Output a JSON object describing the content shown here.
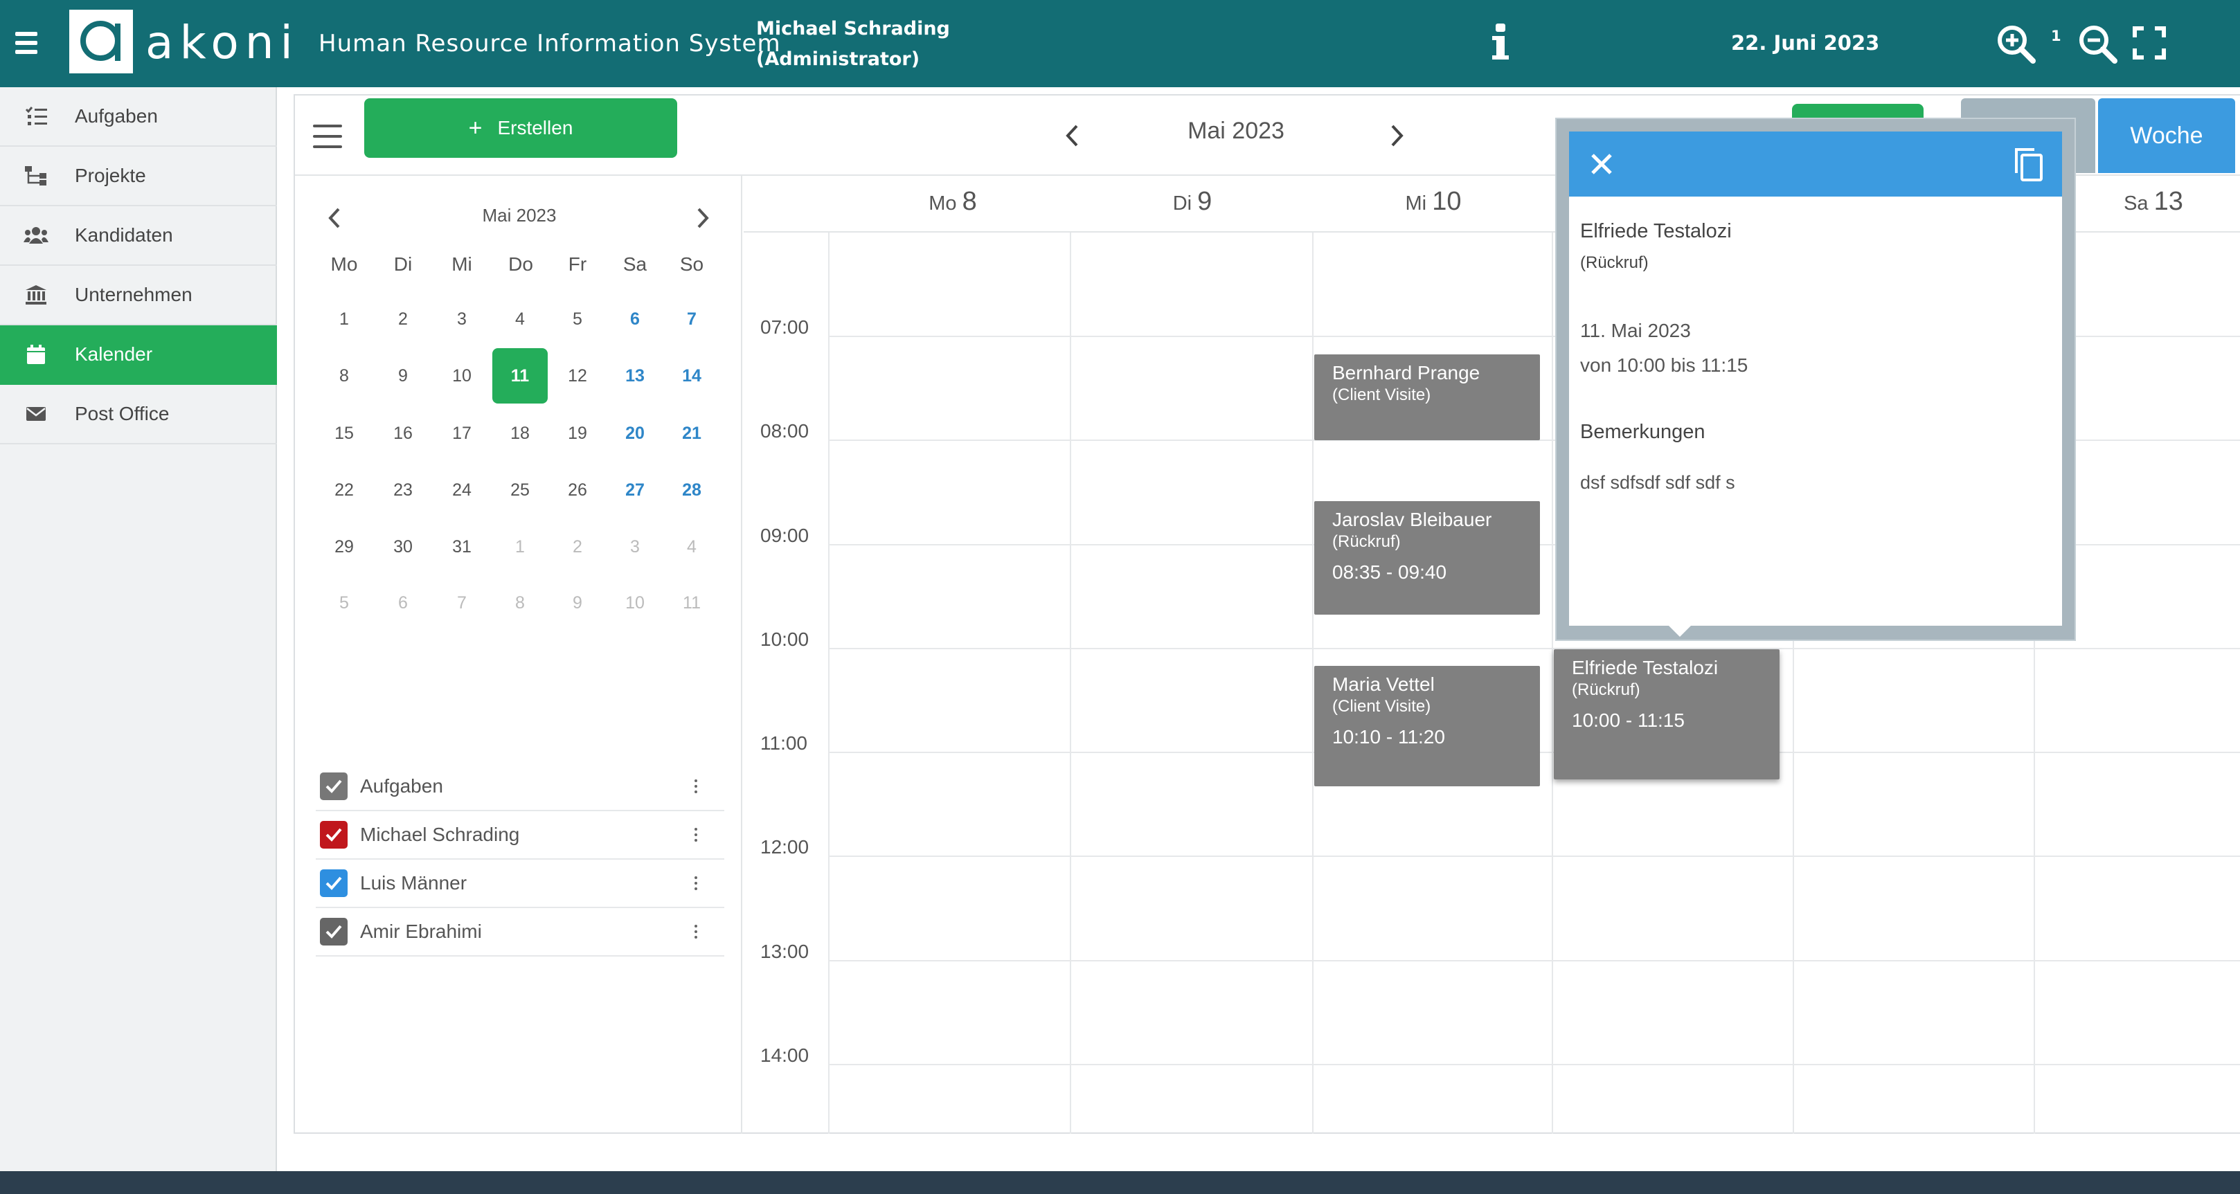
{
  "header": {
    "logo_text": "akoni",
    "app_title": "Human Resource Information System",
    "user_name": "Michael Schrading",
    "user_role": "(Administrator)",
    "date": "22. Juni 2023",
    "zoom_level": "1",
    "colors": {
      "bar": "#136d74"
    }
  },
  "sidebar": {
    "items": [
      {
        "label": "Aufgaben",
        "icon": "task-list-icon"
      },
      {
        "label": "Projekte",
        "icon": "project-tree-icon"
      },
      {
        "label": "Kandidaten",
        "icon": "users-icon"
      },
      {
        "label": "Unternehmen",
        "icon": "bank-icon"
      },
      {
        "label": "Kalender",
        "icon": "calendar-icon",
        "active": true
      },
      {
        "label": "Post Office",
        "icon": "envelope-icon"
      }
    ],
    "active_color": "#24ad5a"
  },
  "toolbar": {
    "create_label": "Erstellen",
    "month_title": "Mai 2023",
    "week_label": "Woche"
  },
  "mini_calendar": {
    "title": "Mai 2023",
    "weekdays": [
      "Mo",
      "Di",
      "Mi",
      "Do",
      "Fr",
      "Sa",
      "So"
    ],
    "weeks": [
      [
        "1",
        "2",
        "3",
        "4",
        "5",
        "6",
        "7"
      ],
      [
        "8",
        "9",
        "10",
        "11",
        "12",
        "13",
        "14"
      ],
      [
        "15",
        "16",
        "17",
        "18",
        "19",
        "20",
        "21"
      ],
      [
        "22",
        "23",
        "24",
        "25",
        "26",
        "27",
        "28"
      ],
      [
        "29",
        "30",
        "31",
        "1",
        "2",
        "3",
        "4"
      ],
      [
        "5",
        "6",
        "7",
        "8",
        "9",
        "10",
        "11"
      ]
    ],
    "selected": "11"
  },
  "calendars": [
    {
      "name": "Aufgaben",
      "color": "#777777"
    },
    {
      "name": "Michael Schrading",
      "color": "#c0171c"
    },
    {
      "name": "Luis Männer",
      "color": "#2e8fe0"
    },
    {
      "name": "Amir Ebrahimi",
      "color": "#666666"
    }
  ],
  "week": {
    "days": [
      {
        "wd": "Mo",
        "num": "8"
      },
      {
        "wd": "Di",
        "num": "9"
      },
      {
        "wd": "Mi",
        "num": "10"
      },
      {
        "wd": "Sa",
        "num": "13"
      }
    ],
    "times": [
      "07:00",
      "08:00",
      "09:00",
      "10:00",
      "11:00",
      "12:00",
      "13:00",
      "14:00"
    ]
  },
  "events": [
    {
      "title": "Bernhard Prange",
      "type": "(Client Visite)",
      "time": ""
    },
    {
      "title": "Jaroslav Bleibauer",
      "type": "(Rückruf)",
      "time": "08:35 - 09:40"
    },
    {
      "title": "Maria Vettel",
      "type": "(Client Visite)",
      "time": "10:10 - 11:20"
    },
    {
      "title": "Elfriede Testalozi",
      "type": "(Rückruf)",
      "time": "10:00 - 11:15"
    }
  ],
  "popover": {
    "name": "Elfriede Testalozi",
    "type": "(Rückruf)",
    "date": "11. Mai 2023",
    "time_range": "von 10:00 bis 11:15",
    "notes_label": "Bemerkungen",
    "notes": "dsf sdfsdf sdf sdf s",
    "header_color": "#3c9be0"
  }
}
